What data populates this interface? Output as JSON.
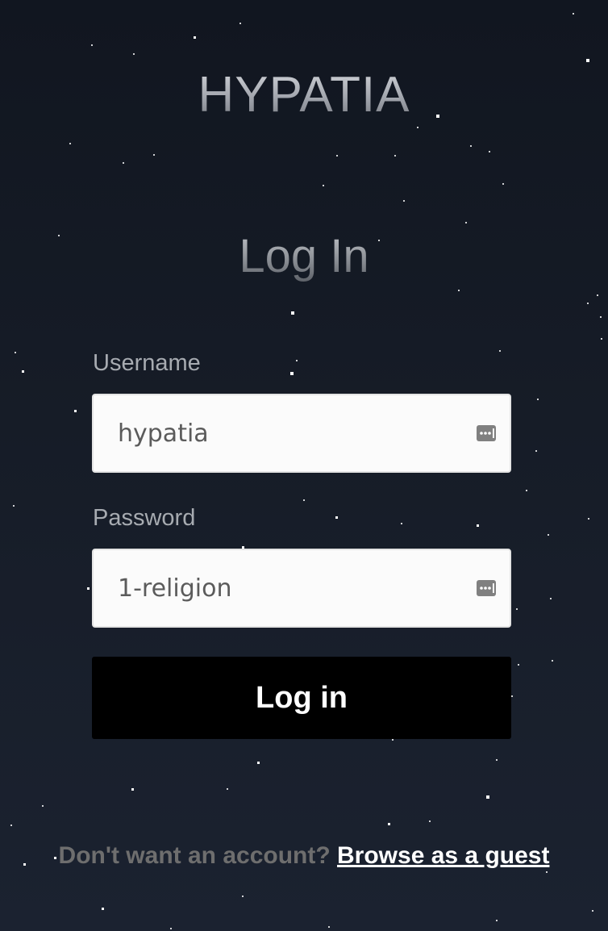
{
  "brand": {
    "title": "HYPATIA"
  },
  "page": {
    "heading": "Log In"
  },
  "form": {
    "username": {
      "label": "Username",
      "value": "hypatia",
      "autofill_icon": "password-manager-key-icon"
    },
    "password": {
      "label": "Password",
      "value": "1-religion",
      "autofill_icon": "password-manager-key-icon"
    },
    "submit_label": "Log in"
  },
  "footer": {
    "prompt": "Don't want an account?",
    "guest_link": "Browse as a guest"
  },
  "colors": {
    "background": "#141a24",
    "button": "#000000",
    "button_text": "#ffffff",
    "input_bg": "#fbfbfb",
    "muted_text": "#6e6e6e"
  }
}
